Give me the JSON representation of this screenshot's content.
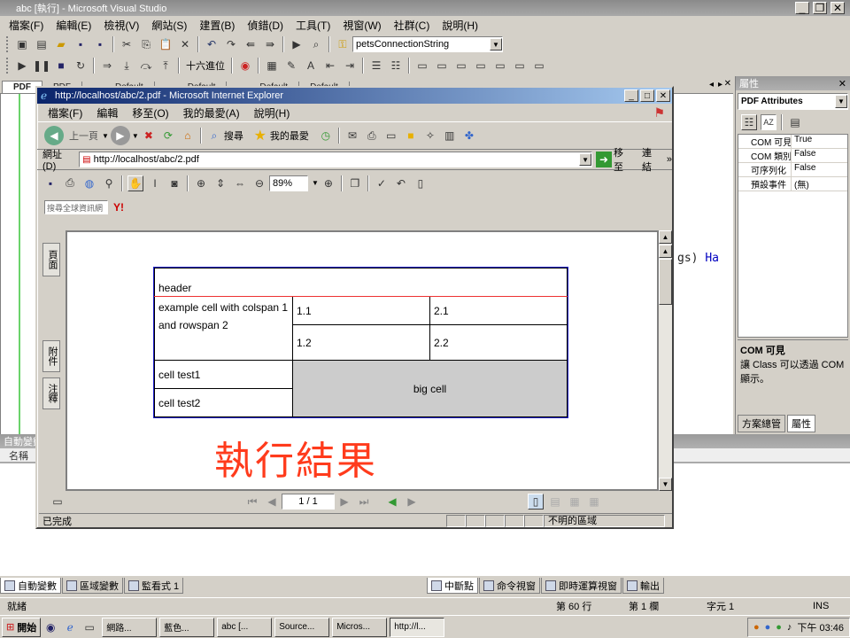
{
  "vs": {
    "title": "abc [執行] - Microsoft Visual Studio",
    "menu": [
      "檔案(F)",
      "編輯(E)",
      "檢視(V)",
      "網站(S)",
      "建置(B)",
      "偵錯(D)",
      "工具(T)",
      "視窗(W)",
      "社群(C)",
      "說明(H)"
    ],
    "connection_combo": "petsConnectionString",
    "hex_label": "十六進位",
    "doc_tabs": [
      "PDF",
      "PDF",
      "",
      "Default",
      "",
      "Default",
      "",
      "Default",
      "Default"
    ],
    "code_fragment": "gs)",
    "code_fragment_kw": "Ha"
  },
  "props": {
    "title": "屬性",
    "object": "PDF Attributes",
    "rows": [
      {
        "name": "COM 可見",
        "value": "True"
      },
      {
        "name": "COM 類別",
        "value": "False"
      },
      {
        "name": "可序列化",
        "value": "False"
      },
      {
        "name": "預設事件",
        "value": "(無)"
      }
    ],
    "desc_title": "COM 可見",
    "desc_text": "讓 Class 可以透過 COM 顯示。",
    "tabs": [
      "方案總管",
      "屬性"
    ]
  },
  "autos": {
    "title": "自動變數",
    "col_name": "名稱"
  },
  "debug_tabs_left": [
    "自動變數",
    "區域變數",
    "監看式 1"
  ],
  "debug_tabs_right": [
    "中斷點",
    "命令視窗",
    "即時運算視窗",
    "輸出"
  ],
  "status": {
    "left": "就緒",
    "line": "第 60 行",
    "col": "第 1 欄",
    "char": "字元 1",
    "ins": "INS"
  },
  "taskbar": {
    "start": "開始",
    "tasks": [
      "網路...",
      "藍色...",
      "abc [...",
      "Source...",
      "Micros...",
      "http://l..."
    ],
    "clock": "下午 03:46"
  },
  "ie": {
    "title": "http://localhost/abc/2.pdf - Microsoft Internet Explorer",
    "menu": [
      "檔案(F)",
      "編輯",
      "移至(O)",
      "我的最愛(A)",
      "說明(H)"
    ],
    "back": "上一頁",
    "search": "搜尋",
    "favorites": "我的最愛",
    "address_label": "網址(D)",
    "address": "http://localhost/abc/2.pdf",
    "go": "移至",
    "links": "連結",
    "zoom": "89%",
    "yahoo_placeholder": "搜尋全球資訊網",
    "side_tabs": [
      "頁面",
      "附件",
      "注釋"
    ],
    "page_indicator": "1 / 1",
    "status_left": "已完成",
    "status_zone": "不明的區域"
  },
  "pdf_table": {
    "header": "header",
    "tall_cell": "example cell with colspan 1 and rowspan 2",
    "c11": "1.1",
    "c21": "2.1",
    "c12": "1.2",
    "c22": "2.2",
    "test1": "cell test1",
    "test2": "cell test2",
    "big": "big cell"
  },
  "overlay_text": "執行結果",
  "colors": {
    "accent": "#0a246a",
    "result": "#ff3b1c",
    "bigcell": "#cccccc"
  }
}
